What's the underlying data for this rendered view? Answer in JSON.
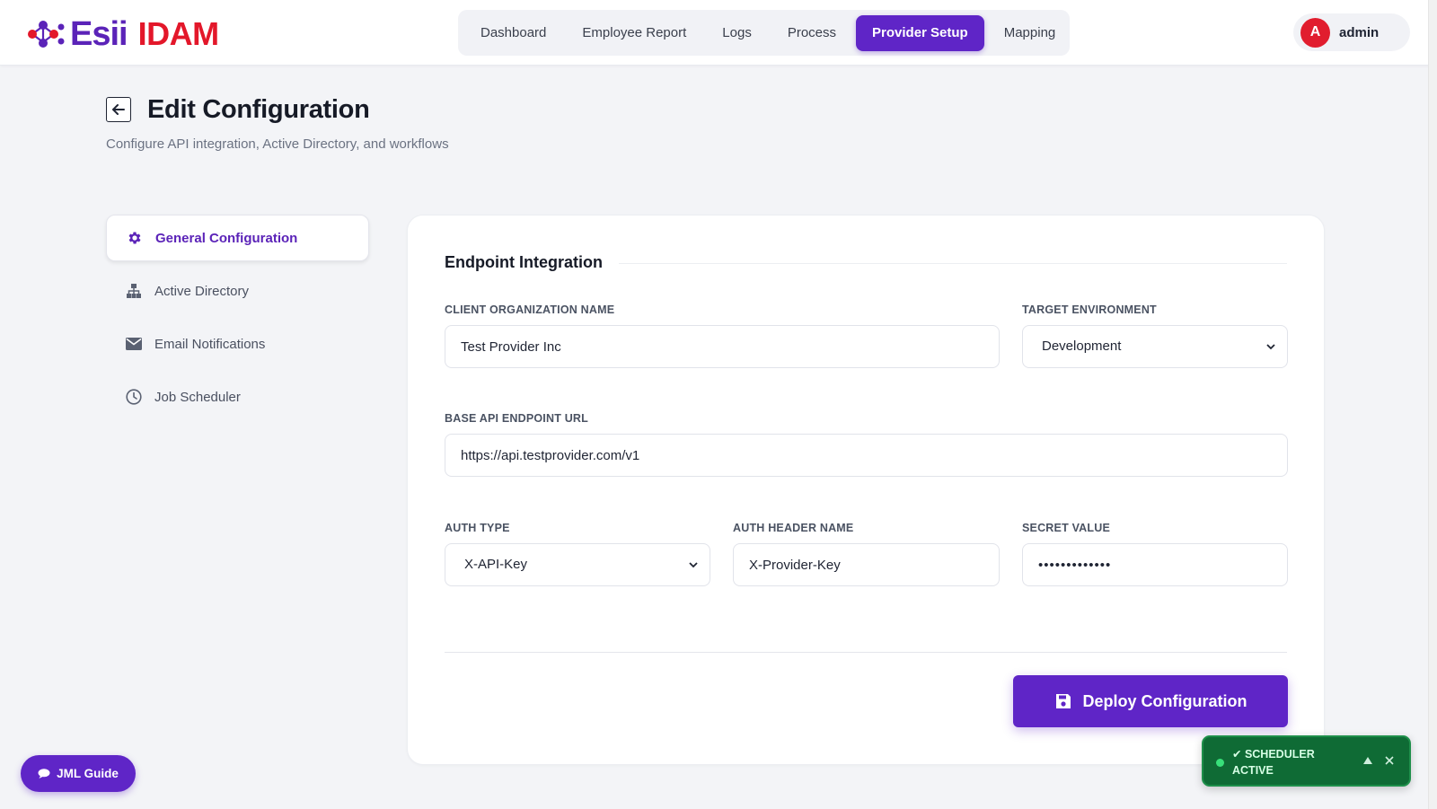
{
  "brand": {
    "name_left": "Esii",
    "name_right": "IDAM",
    "purple": "#5b23b8",
    "red": "#e3172a"
  },
  "nav": {
    "items": [
      {
        "label": "Dashboard"
      },
      {
        "label": "Employee Report"
      },
      {
        "label": "Logs"
      },
      {
        "label": "Process"
      },
      {
        "label": "Provider Setup",
        "active": true
      },
      {
        "label": "Mapping"
      }
    ]
  },
  "user": {
    "initial": "A",
    "name": "admin"
  },
  "page": {
    "title": "Edit Configuration",
    "subtitle": "Configure API integration, Active Directory, and workflows"
  },
  "side": {
    "items": [
      {
        "label": "General Configuration",
        "icon": "gear-icon",
        "active": true
      },
      {
        "label": "Active Directory",
        "icon": "sitemap-icon"
      },
      {
        "label": "Email Notifications",
        "icon": "envelope-icon"
      },
      {
        "label": "Job Scheduler",
        "icon": "clock-icon"
      }
    ]
  },
  "form": {
    "section_title": "Endpoint Integration",
    "client_org": {
      "label": "Client Organization Name",
      "value": "Test Provider Inc"
    },
    "target_env": {
      "label": "Target Environment",
      "value": "Development"
    },
    "base_url": {
      "label": "Base API Endpoint URL",
      "value": "https://api.testprovider.com/v1"
    },
    "auth_type": {
      "label": "Auth Type",
      "value": "X-API-Key"
    },
    "auth_header": {
      "label": "Auth Header Name",
      "value": "X-Provider-Key"
    },
    "secret": {
      "label": "Secret Value",
      "value": "•••••••••••••"
    },
    "deploy_label": "Deploy Configuration"
  },
  "jml": {
    "label": "JML Guide"
  },
  "toast": {
    "text": "✔ Scheduler Active"
  },
  "colors": {
    "accent": "#5f25c7",
    "toast_bg": "#0f6b35"
  }
}
